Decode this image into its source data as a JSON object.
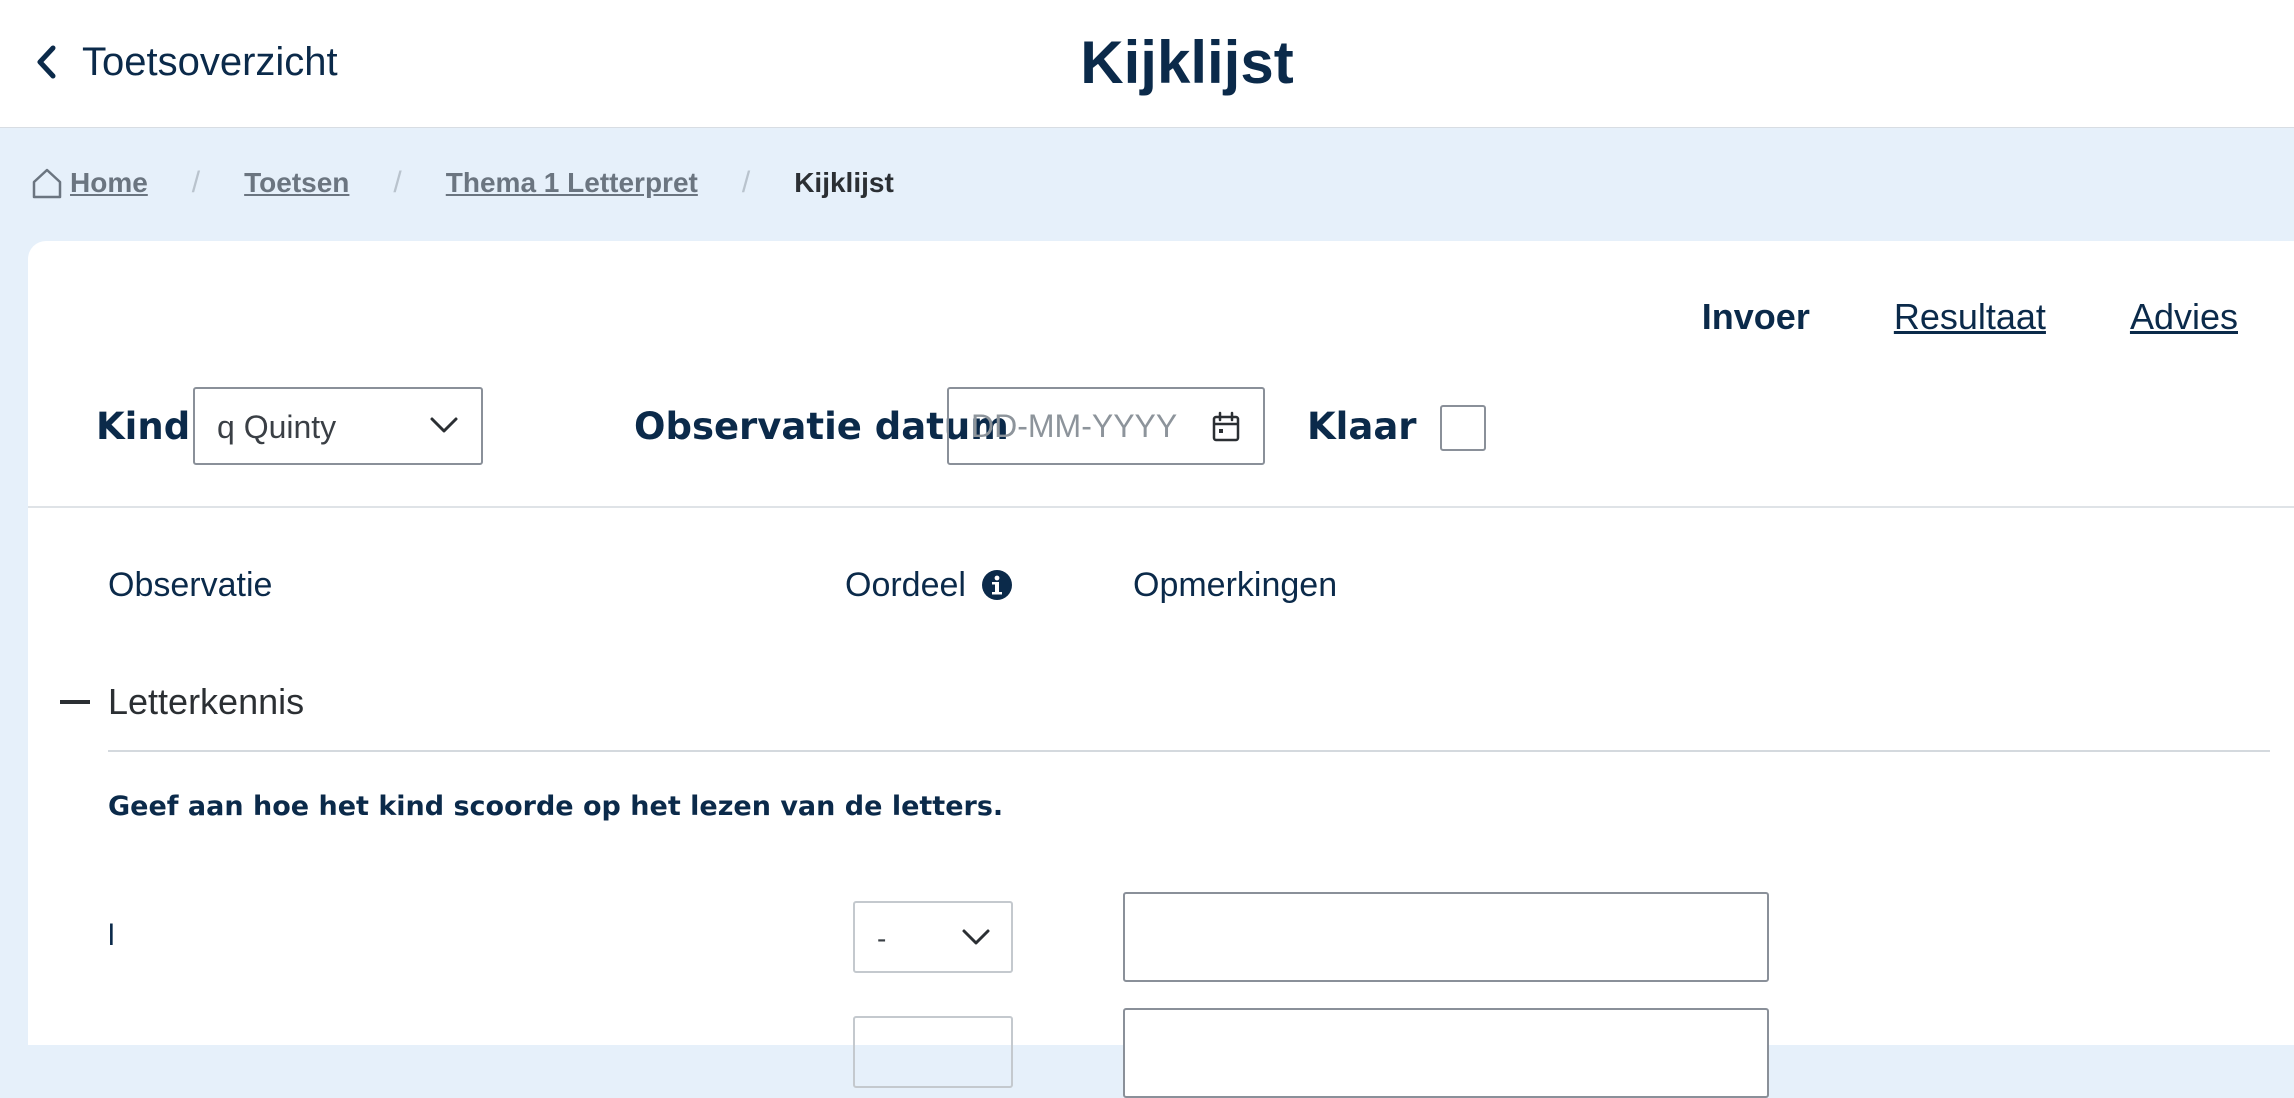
{
  "header": {
    "back_label": "Toetsoverzicht",
    "title": "Kijklijst"
  },
  "breadcrumb": {
    "items": [
      "Home",
      "Toetsen",
      "Thema 1 Letterpret"
    ],
    "current": "Kijklijst",
    "separator": "/"
  },
  "tabs": {
    "items": [
      {
        "label": "Invoer",
        "active": true
      },
      {
        "label": "Resultaat",
        "active": false
      },
      {
        "label": "Advies",
        "active": false
      }
    ]
  },
  "filters": {
    "child_label": "Kind",
    "child_value": "q Quinty",
    "date_label": "Observatie datum",
    "date_placeholder": "DD-MM-YYYY",
    "done_label": "Klaar",
    "done_checked": false
  },
  "columns": {
    "observation": "Observatie",
    "judgement": "Oordeel",
    "remarks": "Opmerkingen"
  },
  "section": {
    "title": "Letterkennis",
    "instruction": "Geef aan hoe het kind scoorde op het lezen van de letters.",
    "rows": [
      {
        "label": "l",
        "judgement": "-",
        "remark": ""
      },
      {
        "label": "",
        "judgement": "",
        "remark": ""
      }
    ]
  },
  "icons": {
    "back": "chevron-left-icon",
    "home": "home-icon",
    "dropdown": "chevron-down-icon",
    "calendar": "calendar-icon",
    "info": "info-icon",
    "collapse": "minus-icon"
  },
  "colors": {
    "primary": "#0b2a4a",
    "background": "#e6f0fa",
    "card": "#ffffff",
    "border": "#8a9099"
  }
}
